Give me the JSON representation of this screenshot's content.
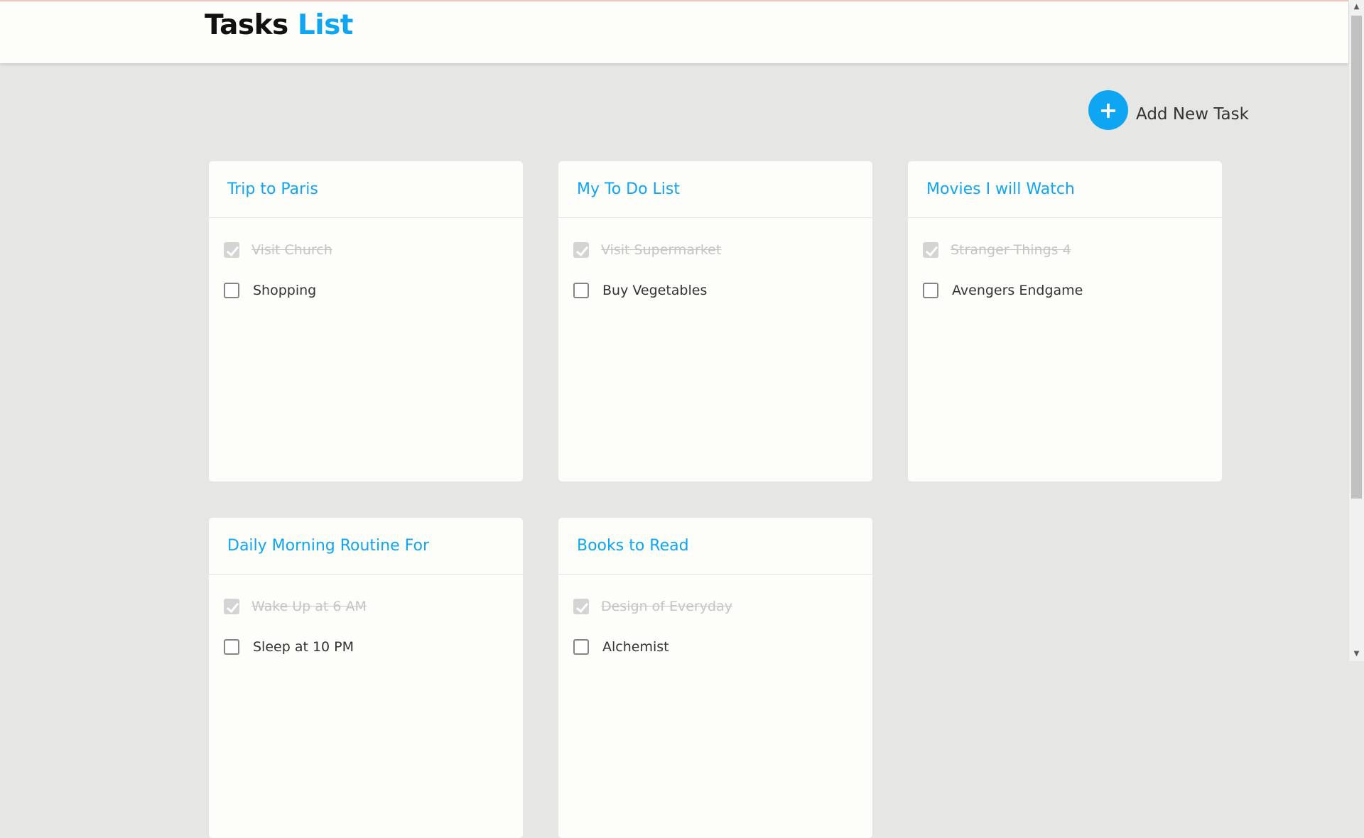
{
  "header": {
    "title_part1": "Tasks",
    "title_part2": "List"
  },
  "add_task": {
    "icon": "plus-icon",
    "icon_glyph": "+",
    "label": "Add New Task"
  },
  "colors": {
    "accent": "#0ea5f2",
    "background": "#e6e6e4",
    "card": "#fdfdfa",
    "done_text": "#c4c4c4"
  },
  "lists": [
    {
      "title": "Trip to Paris",
      "tasks": [
        {
          "label": "Visit Church",
          "done": true
        },
        {
          "label": "Shopping",
          "done": false
        }
      ]
    },
    {
      "title": "My To Do List",
      "tasks": [
        {
          "label": "Visit Supermarket",
          "done": true
        },
        {
          "label": "Buy Vegetables",
          "done": false
        }
      ]
    },
    {
      "title": "Movies I will Watch",
      "tasks": [
        {
          "label": "Stranger Things 4",
          "done": true
        },
        {
          "label": "Avengers Endgame",
          "done": false
        }
      ]
    },
    {
      "title": "Daily Morning Routine For",
      "tasks": [
        {
          "label": "Wake Up at 6 AM",
          "done": true
        },
        {
          "label": "Sleep at 10 PM",
          "done": false
        }
      ]
    },
    {
      "title": "Books to Read",
      "tasks": [
        {
          "label": "Design of Everyday",
          "done": true
        },
        {
          "label": "Alchemist",
          "done": false
        }
      ]
    }
  ]
}
